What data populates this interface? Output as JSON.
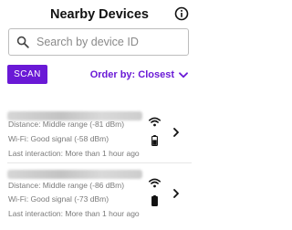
{
  "header": {
    "title": "Nearby Devices",
    "info_icon": "info-icon"
  },
  "search": {
    "placeholder": "Search by device ID",
    "value": ""
  },
  "controls": {
    "scan_label": "SCAN",
    "order_label": "Order by: Closest"
  },
  "colors": {
    "accent": "#6a19d6"
  },
  "devices": [
    {
      "distance": "Distance: Middle range (-81 dBm)",
      "wifi": "Wi-Fi: Good signal (-58 dBm)",
      "last_interaction": "Last interaction: More than 1 hour ago",
      "battery_icon": "battery-half-icon"
    },
    {
      "distance": "Distance: Middle range (-86 dBm)",
      "wifi": "Wi-Fi: Good signal (-73 dBm)",
      "last_interaction": "Last interaction: More than 1 hour ago",
      "battery_icon": "battery-full-icon"
    }
  ]
}
